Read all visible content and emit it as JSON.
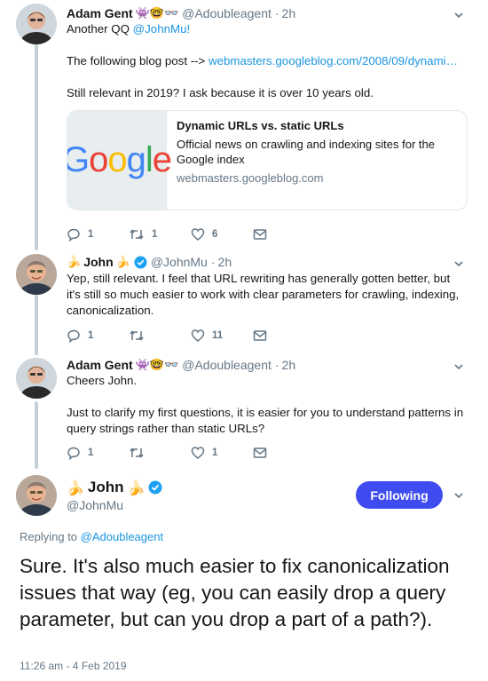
{
  "tweets": [
    {
      "name": "Adam Gent",
      "emoji": "👾🤓👓",
      "handle": "@Adoubleagent",
      "time": "2h",
      "line1_prefix": "Another QQ ",
      "line1_mention": "@JohnMu!",
      "line2_prefix": "The following blog post --> ",
      "line2_link": "webmasters.googleblog.com/2008/09/dynami…",
      "line3": "Still relevant in 2019? I ask because it is over 10 years old.",
      "card": {
        "logo_text": "Google",
        "title": "Dynamic URLs vs. static URLs",
        "description": "Official news on crawling and indexing sites for the Google index",
        "domain": "webmasters.googleblog.com"
      },
      "actions": {
        "replies": "1",
        "retweets": "1",
        "likes": "6"
      }
    },
    {
      "emoji_prefix": "🍌",
      "name": "John",
      "emoji_suffix": "🍌",
      "handle": "@JohnMu",
      "time": "2h",
      "body": "Yep, still relevant. I feel that URL rewriting has generally gotten better, but it's still so much easier to work with clear parameters for crawling, indexing, canonicalization.",
      "actions": {
        "replies": "1",
        "retweets": "",
        "likes": "11"
      }
    },
    {
      "name": "Adam Gent",
      "emoji": "👾🤓👓",
      "handle": "@Adoubleagent",
      "time": "2h",
      "line1": "Cheers John.",
      "line2": "Just to clarify my first questions, it is easier for you to understand patterns in query strings rather than static URLs?",
      "actions": {
        "replies": "1",
        "retweets": "",
        "likes": "1"
      }
    }
  ],
  "main_tweet": {
    "emoji_prefix": "🍌",
    "name": "John",
    "emoji_suffix": "🍌",
    "handle": "@JohnMu",
    "follow_label": "Following",
    "replying_prefix": "Replying to ",
    "replying_handle": "@Adoubleagent",
    "body": "Sure. It's also much easier to fix canonicalization issues that way (eg, you can easily drop a query parameter, but can you drop a part of a path?).",
    "timestamp": "11:26 am - 4 Feb 2019"
  },
  "colors": {
    "link": "#1b95e0",
    "meta": "#657786",
    "button": "#3f4cf0",
    "thread_line": "#c4cfd6"
  },
  "icons": [
    "reply-icon",
    "retweet-icon",
    "like-icon",
    "direct-message-icon",
    "verified-icon",
    "chevron-down-icon"
  ]
}
